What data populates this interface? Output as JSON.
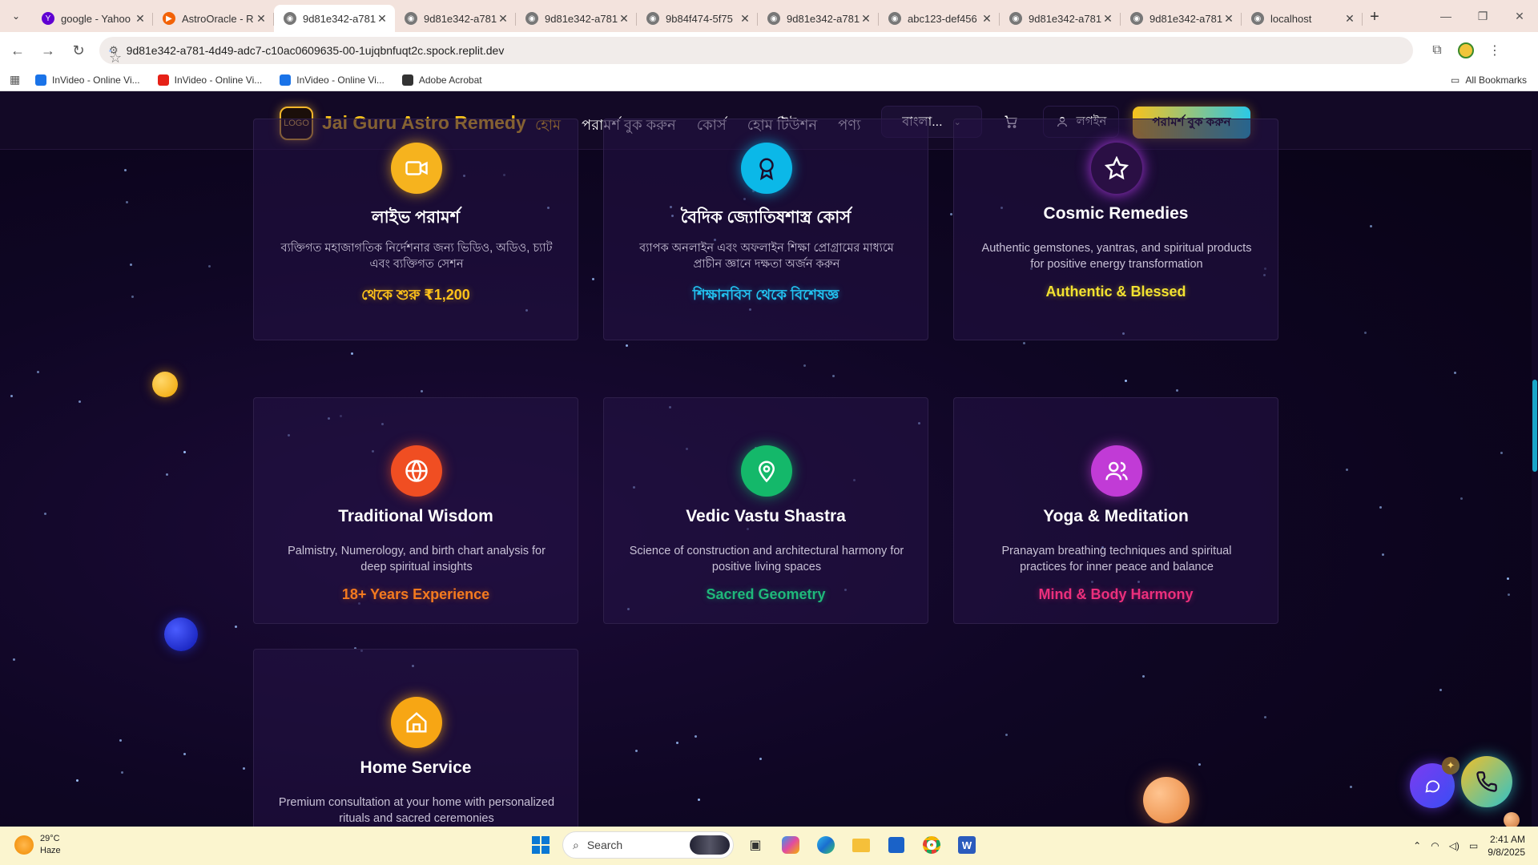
{
  "browser": {
    "tabs": [
      {
        "title": "google - Yahoo",
        "favicon_color": "#6001d2",
        "favicon_glyph": "Y"
      },
      {
        "title": "AstroOracle - R",
        "favicon_color": "#f26207",
        "favicon_glyph": "▶"
      },
      {
        "title": "9d81e342-a781",
        "favicon_color": "#777777",
        "favicon_glyph": "◉",
        "active": true
      },
      {
        "title": "9d81e342-a781",
        "favicon_color": "#777777",
        "favicon_glyph": "◉"
      },
      {
        "title": "9d81e342-a781",
        "favicon_color": "#777777",
        "favicon_glyph": "◉"
      },
      {
        "title": "9b84f474-5f75",
        "favicon_color": "#777777",
        "favicon_glyph": "◉"
      },
      {
        "title": "9d81e342-a781",
        "favicon_color": "#777777",
        "favicon_glyph": "◉"
      },
      {
        "title": "abc123-def456",
        "favicon_color": "#777777",
        "favicon_glyph": "◉"
      },
      {
        "title": "9d81e342-a781",
        "favicon_color": "#777777",
        "favicon_glyph": "◉"
      },
      {
        "title": "9d81e342-a781",
        "favicon_color": "#777777",
        "favicon_glyph": "◉"
      },
      {
        "title": "localhost",
        "favicon_color": "#777777",
        "favicon_glyph": "◉"
      }
    ],
    "url": "9d81e342-a781-4d49-adc7-c10ac0609635-00-1ujqbnfuqt2c.spock.replit.dev",
    "bookmarks": [
      {
        "label": "InVideo - Online Vi...",
        "color": "#1a73e8"
      },
      {
        "label": "InVideo - Online Vi...",
        "color": "#e62117"
      },
      {
        "label": "InVideo - Online Vi...",
        "color": "#1a73e8"
      },
      {
        "label": "Adobe Acrobat",
        "color": "#333333"
      }
    ],
    "all_bookmarks": "All Bookmarks"
  },
  "site": {
    "logo_text": "LOGO",
    "brand": "Jai Guru Astro Remedy",
    "nav": [
      "হোম",
      "পরামর্শ বুক করুন",
      "কোর্স",
      "হোম টিউশন",
      "পণ্য"
    ],
    "language": "বাংলা...",
    "login": "লগইন",
    "cta": "পরামর্শ বুক করুন"
  },
  "cards": [
    {
      "icon": "video-icon",
      "icon_color": "#f6b31e",
      "title": "লাইভ পরামর্শ",
      "desc": "ব্যক্তিগত মহাজাগতিক নির্দেশনার জন্য ভিডিও, অডিও, চ্যাট এবং ব্যক্তিগত সেশন",
      "tag": "থেকে শুরু ₹1,200",
      "tag_color": "#ffc21a"
    },
    {
      "icon": "award-icon",
      "icon_color": "#0bb8e8",
      "title": "বৈদিক জ্যোতিষশাস্ত্র কোর্স",
      "desc": "ব্যাপক অনলাইন এবং অফলাইন শিক্ষা প্রোগ্রামের মাধ্যমে প্রাচীন জ্ঞানে দক্ষতা অর্জন করুন",
      "tag": "শিক্ষানবিস থেকে বিশেষজ্ঞ",
      "tag_color": "#22c2f0"
    },
    {
      "icon": "star-icon",
      "icon_color": "#2a0f44",
      "title": "Cosmic Remedies",
      "desc": "Authentic gemstones, yantras, and spiritual products for positive energy transformation",
      "tag": "Authentic & Blessed",
      "tag_color": "#f3e230"
    },
    {
      "icon": "globe-icon",
      "icon_color": "#f04e22",
      "title": "Traditional Wisdom",
      "desc": "Palmistry, Numerology, and birth chart analysis for deep spiritual insights",
      "tag": "18+ Years Experience",
      "tag_color": "#f47a1f"
    },
    {
      "icon": "map-pin-icon",
      "icon_color": "#14b86a",
      "title": "Vedic Vastu Shastra",
      "desc": "Science of construction and architectural harmony for positive living spaces",
      "tag": "Sacred Geometry",
      "tag_color": "#1fb87a"
    },
    {
      "icon": "users-icon",
      "icon_color": "#c13bd6",
      "title": "Yoga & Meditation",
      "desc": "Pranayam breathing techniques and spiritual practices for inner peace and balance",
      "tag": "Mind & Body Harmony",
      "tag_color": "#ec2f7c"
    },
    {
      "icon": "home-icon",
      "icon_color": "#f7a614",
      "title": "Home Service",
      "desc": "Premium consultation at your home with personalized rituals and sacred ceremonies",
      "tag": "",
      "tag_color": "#ffc21a"
    }
  ],
  "taskbar": {
    "temp": "29°C",
    "weather": "Haze",
    "search_placeholder": "Search",
    "time": "2:41 AM",
    "date": "9/8/2025"
  }
}
